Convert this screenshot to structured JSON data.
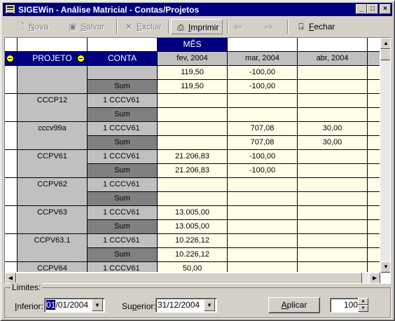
{
  "window": {
    "title": "SIGEWin - Análise Matricial - Contas/Projetos",
    "minimize": "_",
    "maximize": "□",
    "close": "×"
  },
  "toolbar": {
    "new_pre": "",
    "new_ul": "N",
    "new_post": "ova",
    "save_pre": "",
    "save_ul": "S",
    "save_post": "alvar",
    "delete_pre": "",
    "delete_ul": "E",
    "delete_post": "xcluir",
    "print_pre": "",
    "print_ul": "I",
    "print_post": "mprimir",
    "close_pre": "",
    "close_ul": "F",
    "close_post": "echar",
    "back_arrow": "⇦",
    "forward_arrow": "⇨"
  },
  "grid": {
    "column_group_header": "MÊS",
    "row_headers": [
      "PROJETO",
      "CONTA"
    ],
    "months": [
      "fev, 2004",
      "mar, 2004",
      "abr, 2004"
    ],
    "sum_label": "Sum",
    "rows": [
      {
        "projeto": "",
        "conta": "",
        "values": [
          "119,50",
          "-100,00",
          ""
        ],
        "sum": [
          "119,50",
          "-100,00",
          ""
        ]
      },
      {
        "projeto": "CCCP12",
        "conta": "1  CCCV61",
        "values": [
          "",
          "",
          ""
        ],
        "sum": [
          "",
          "",
          ""
        ]
      },
      {
        "projeto": "cccv99a",
        "conta": "1  CCCV61",
        "values": [
          "",
          "707,08",
          "30,00"
        ],
        "sum": [
          "",
          "707,08",
          "30,00"
        ]
      },
      {
        "projeto": "CCPV61",
        "conta": "1  CCCV61",
        "values": [
          "21.206,83",
          "-100,00",
          ""
        ],
        "sum": [
          "21.206,83",
          "-100,00",
          ""
        ]
      },
      {
        "projeto": "CCPV62",
        "conta": "1  CCCV61",
        "values": [
          "",
          "",
          ""
        ],
        "sum": [
          "",
          "",
          ""
        ]
      },
      {
        "projeto": "CCPV63",
        "conta": "1  CCCV61",
        "values": [
          "13.005,00",
          "",
          ""
        ],
        "sum": [
          "13.005,00",
          "",
          ""
        ]
      },
      {
        "projeto": "CCPV63.1",
        "conta": "1  CCCV61",
        "values": [
          "10.226,12",
          "",
          ""
        ],
        "sum": [
          "10.226,12",
          "",
          ""
        ]
      },
      {
        "projeto": "CCPV64",
        "conta": "1  CCCV61",
        "values": [
          "50,00",
          "",
          ""
        ],
        "sum": null
      }
    ]
  },
  "scrollbars": {
    "up": "▲",
    "down": "▼",
    "left": "◀",
    "right": "▶"
  },
  "limits": {
    "group_label": "Limites:",
    "inferior_pre": "",
    "inferior_ul": "I",
    "inferior_post": "nferior:",
    "inferior_value_sel": "01",
    "inferior_value_rest": "/01/2004",
    "superior_pre": "Su",
    "superior_ul": "p",
    "superior_post": "erior:",
    "superior_value": "31/12/2004",
    "dropdown_arrow": "▼",
    "apply_ul": "A",
    "apply_post": "plicar",
    "zoom_value": "100",
    "spin_up": "▲",
    "spin_down": "▼"
  }
}
